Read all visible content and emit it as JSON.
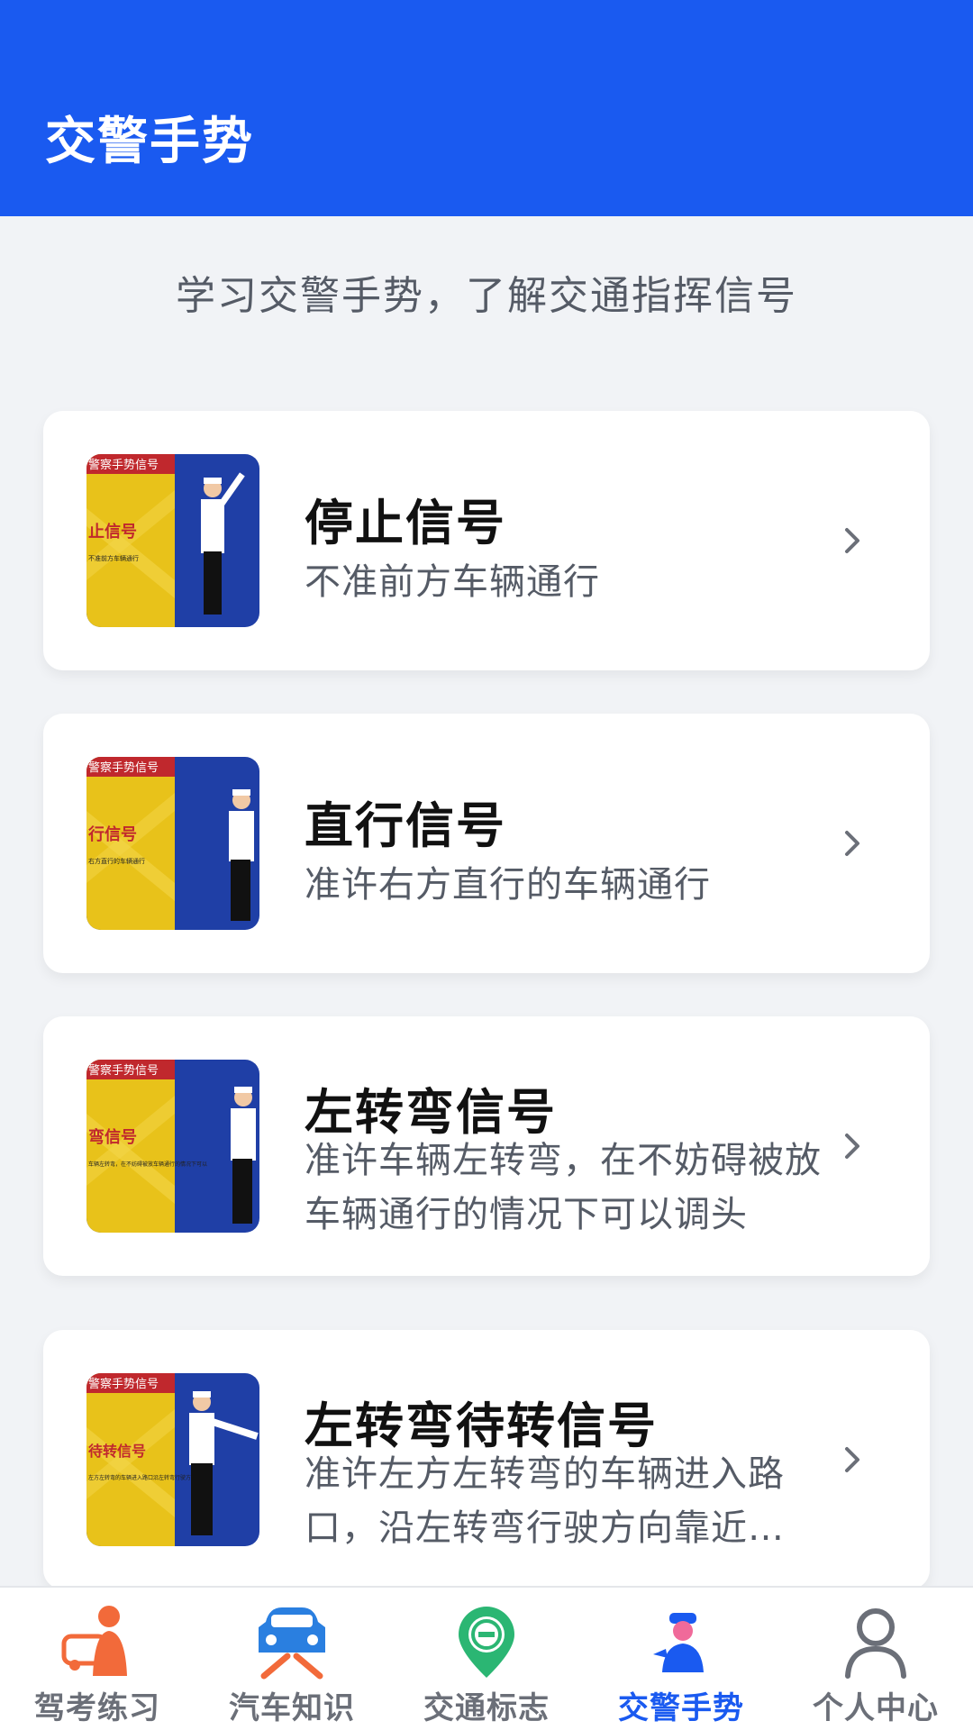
{
  "header": {
    "title": "交警手势"
  },
  "intro": {
    "text": "学习交警手势，了解交通指挥信号"
  },
  "gestures": [
    {
      "title": "停止信号",
      "description": "不准前方车辆通行",
      "thumb_top": "警察手势信号",
      "thumb_label": "止信号",
      "thumb_sub": "不准前方车辆通行"
    },
    {
      "title": "直行信号",
      "description": "准许右方直行的车辆通行",
      "thumb_top": "警察手势信号",
      "thumb_label": "行信号",
      "thumb_sub": "右方直行的车辆通行"
    },
    {
      "title": "左转弯信号",
      "description": "准许车辆左转弯，在不妨碍被放车辆通行的情况下可以调头",
      "thumb_top": "警察手势信号",
      "thumb_label": "弯信号",
      "thumb_sub": "车辆左转弯，在不妨碍被放车辆通行的情况下可以"
    },
    {
      "title": "左转弯待转信号",
      "description": "准许左方左转弯的车辆进入路口，沿左转弯行驶方向靠近…",
      "thumb_top": "警察手势信号",
      "thumb_label": "待转信号",
      "thumb_sub": "左方左转弯的车辆进入路口沿左转弯行驶方向靠近"
    }
  ],
  "tabs": [
    {
      "label": "驾考练习",
      "icon": "driving-test-icon"
    },
    {
      "label": "汽车知识",
      "icon": "car-knowledge-icon"
    },
    {
      "label": "交通标志",
      "icon": "traffic-sign-icon"
    },
    {
      "label": "交警手势",
      "icon": "police-gesture-icon",
      "active": true
    },
    {
      "label": "个人中心",
      "icon": "user-icon"
    }
  ],
  "colors": {
    "primary": "#1a5af0",
    "background": "#f1f3f6",
    "accent_orange": "#f26a3a",
    "accent_green": "#2bb673"
  }
}
